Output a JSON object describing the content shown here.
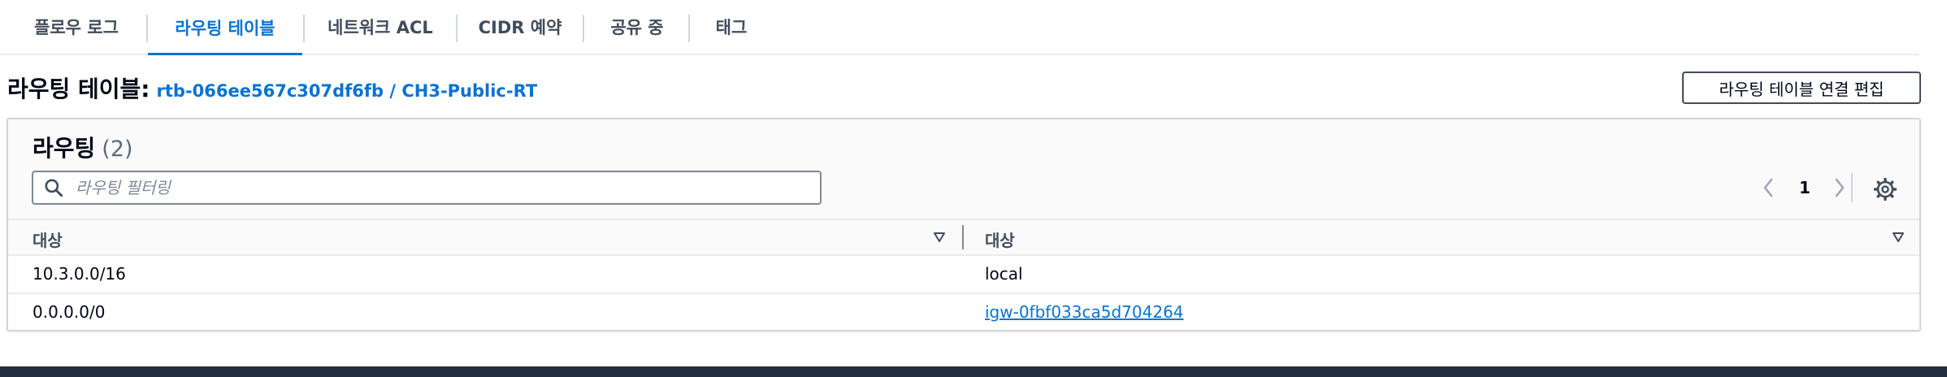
{
  "tabs": [
    {
      "label": "플로우 로그",
      "active": false
    },
    {
      "label": "라우팅 테이블",
      "active": true
    },
    {
      "label": "네트워크 ACL",
      "active": false
    },
    {
      "label": "CIDR 예약",
      "active": false
    },
    {
      "label": "공유 중",
      "active": false
    },
    {
      "label": "태그",
      "active": false
    }
  ],
  "route_table": {
    "title": "라우팅 테이블:",
    "id_label": "rtb-066ee567c307df6fb / CH3-Public-RT",
    "edit_button": "라우팅 테이블 연결 편집"
  },
  "routes_panel": {
    "title": "라우팅",
    "count": "(2)",
    "filter_placeholder": "라우팅 필터링",
    "filter_value": "",
    "page": "1",
    "columns": [
      "대상",
      "대상"
    ],
    "rows": [
      {
        "destination": "10.3.0.0/16",
        "target": "local",
        "target_is_link": false
      },
      {
        "destination": "0.0.0.0/0",
        "target": "igw-0fbf033ca5d704264",
        "target_is_link": true
      }
    ]
  },
  "colors": {
    "accent": "#0972d3",
    "text": "#000716",
    "muted": "#414d5c",
    "border": "#d1d5db",
    "footer": "#232f3e"
  },
  "icons": {
    "search": "search-icon",
    "prev": "chevron-left-icon",
    "next": "chevron-right-icon",
    "settings": "gear-icon",
    "sort": "caret-down-icon"
  }
}
